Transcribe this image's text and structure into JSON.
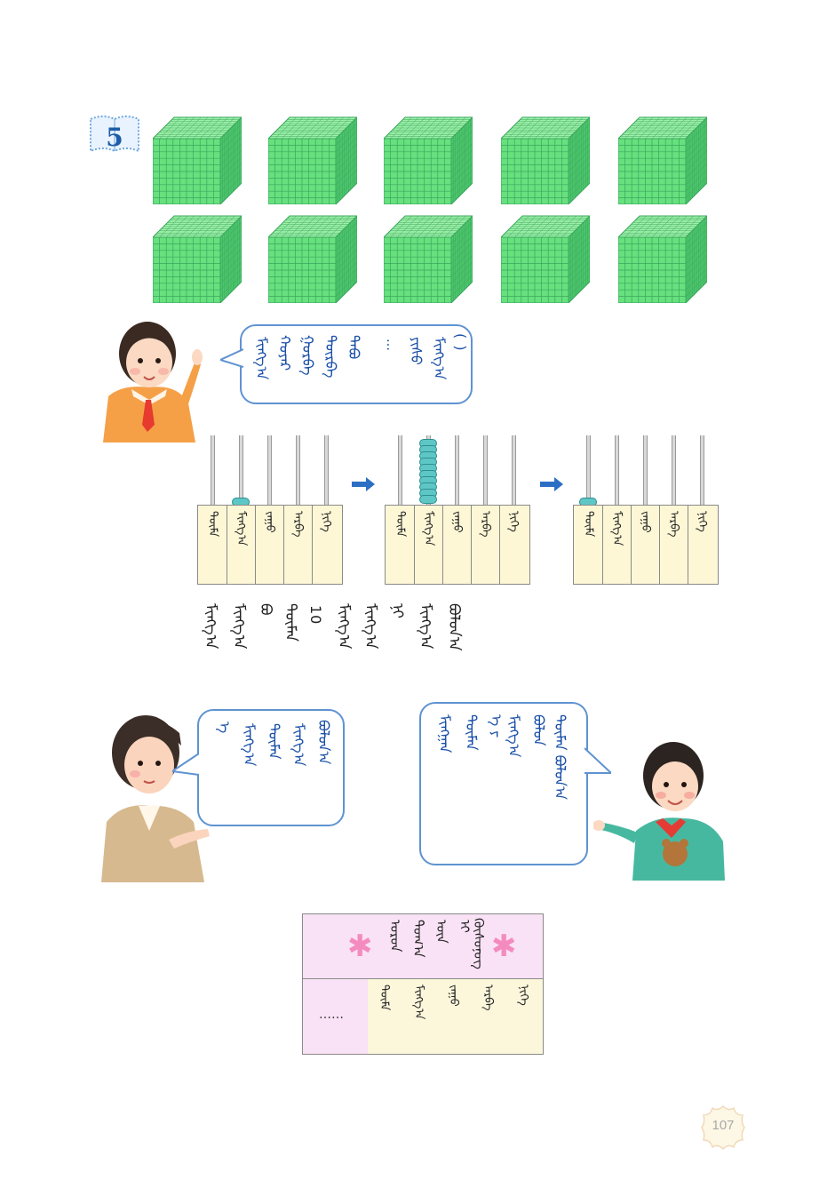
{
  "badge": {
    "number": "5",
    "icon": "book-icon"
  },
  "cubes": {
    "count": 10,
    "rows": 2,
    "cols": 5,
    "color": "#67e07e",
    "grid_color": "#3aa75e"
  },
  "girl_bubble": {
    "ellipsis": "…"
  },
  "abacus_caption": {
    "number": "10"
  },
  "arrows": {
    "icon": "arrow-right-icon",
    "color": "#2b6fc4"
  },
  "place_value_table": {
    "ellipsis": "……",
    "star_icon": "asterisk-icon",
    "star_color": "#f48bbf"
  },
  "page": {
    "number": "107"
  }
}
